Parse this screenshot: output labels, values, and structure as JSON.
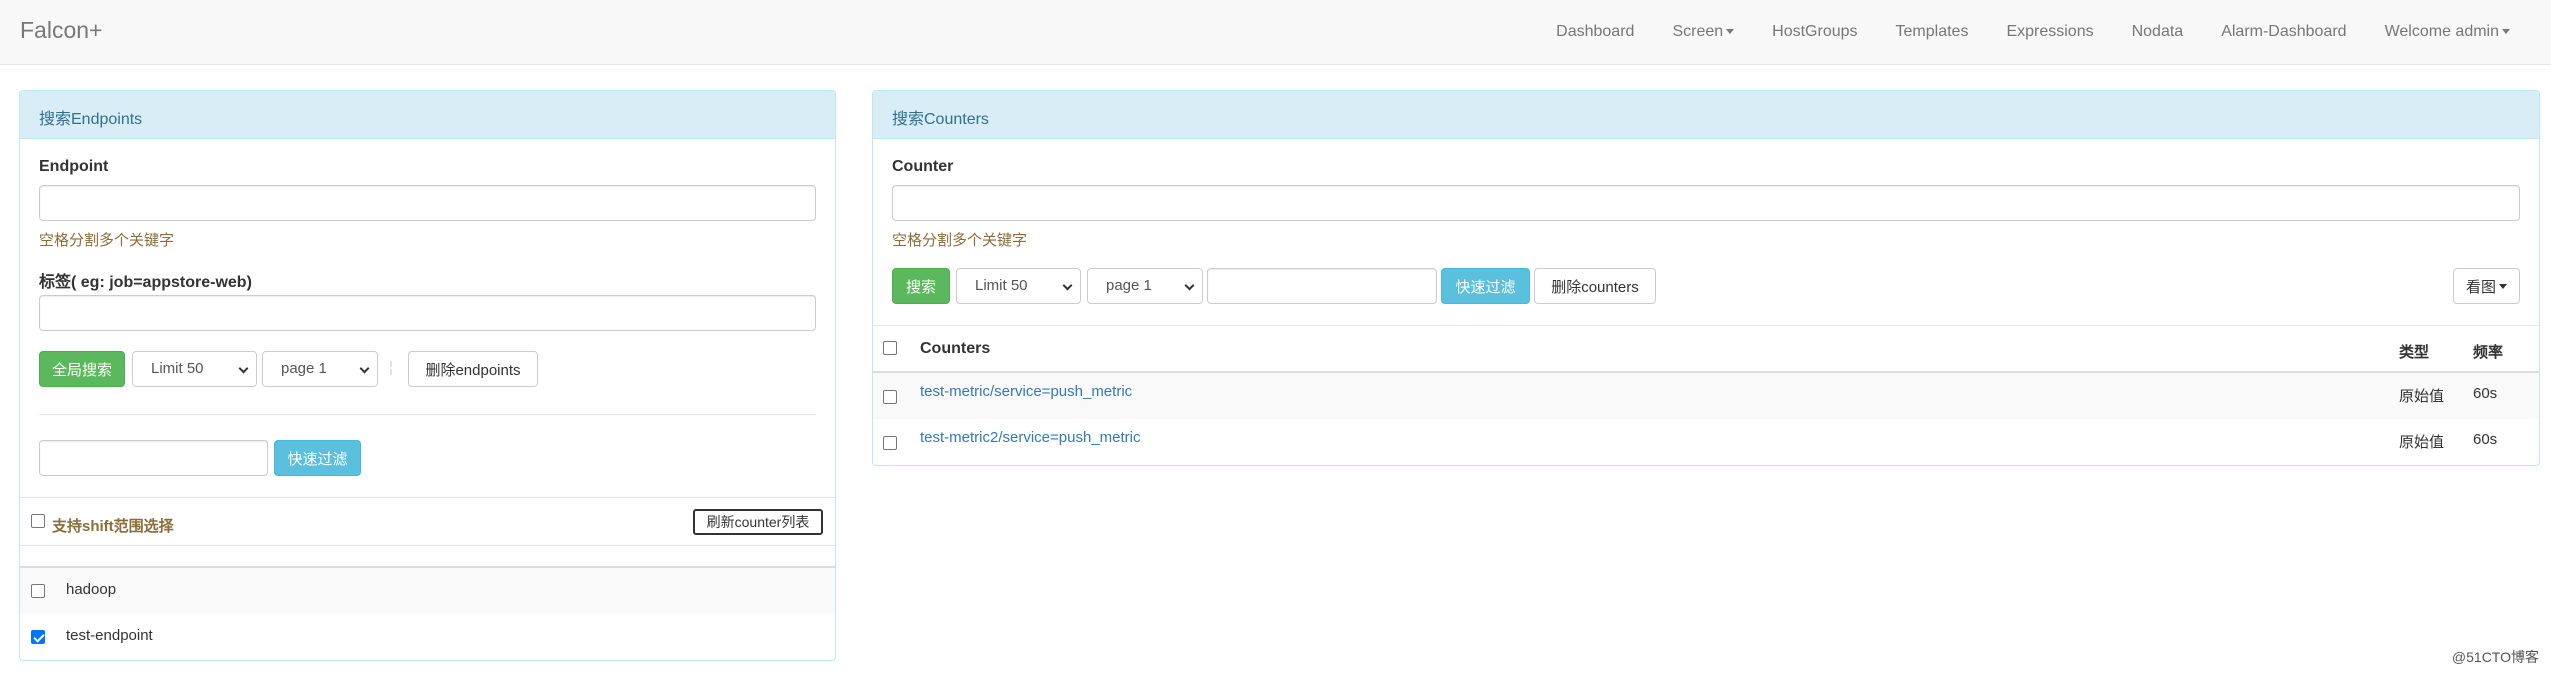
{
  "navbar": {
    "brand": "Falcon+",
    "items": [
      {
        "label": "Dashboard",
        "dropdown": false
      },
      {
        "label": "Screen",
        "dropdown": true
      },
      {
        "label": "HostGroups",
        "dropdown": false
      },
      {
        "label": "Templates",
        "dropdown": false
      },
      {
        "label": "Expressions",
        "dropdown": false
      },
      {
        "label": "Nodata",
        "dropdown": false
      },
      {
        "label": "Alarm-Dashboard",
        "dropdown": false
      },
      {
        "label": "Welcome admin",
        "dropdown": true
      }
    ]
  },
  "endpoints_panel": {
    "title": "搜索Endpoints",
    "endpoint_label": "Endpoint",
    "endpoint_value": "",
    "endpoint_help": "空格分割多个关键字",
    "tag_label": "标签( eg: job=appstore-web)",
    "tag_value": "",
    "search_all_button": "全局搜索",
    "limit_select": "Limit 50",
    "page_select": "page 1",
    "separator": "¦",
    "delete_button": "删除endpoints",
    "filter_value": "",
    "quick_filter_button": "快速过滤",
    "shift_select_label": "支持shift范围选择",
    "refresh_button": "刷新counter列表",
    "endpoints": [
      {
        "name": "hadoop",
        "checked": false
      },
      {
        "name": "test-endpoint",
        "checked": true
      }
    ]
  },
  "counters_panel": {
    "title": "搜索Counters",
    "counter_label": "Counter",
    "counter_value": "",
    "counter_help": "空格分割多个关键字",
    "search_button": "搜索",
    "limit_select": "Limit 50",
    "page_select": "page 1",
    "filter_value": "",
    "quick_filter_button": "快速过滤",
    "delete_button": "删除counters",
    "view_graph_button": "看图",
    "table": {
      "headers": [
        "Counters",
        "类型",
        "频率"
      ],
      "rows": [
        {
          "counter": "test-metric/service=push_metric",
          "type": "原始值",
          "frequency": "60s",
          "checked": false
        },
        {
          "counter": "test-metric2/service=push_metric",
          "type": "原始值",
          "frequency": "60s",
          "checked": false
        }
      ]
    }
  },
  "colors": {
    "panel_heading_bg": "#d9edf7",
    "panel_heading_text": "#31708f",
    "success": "#5cb85c",
    "info": "#5bc0de",
    "link": "#337ab7",
    "help_text": "#8a6d3b"
  },
  "watermark": "@51CTO博客"
}
